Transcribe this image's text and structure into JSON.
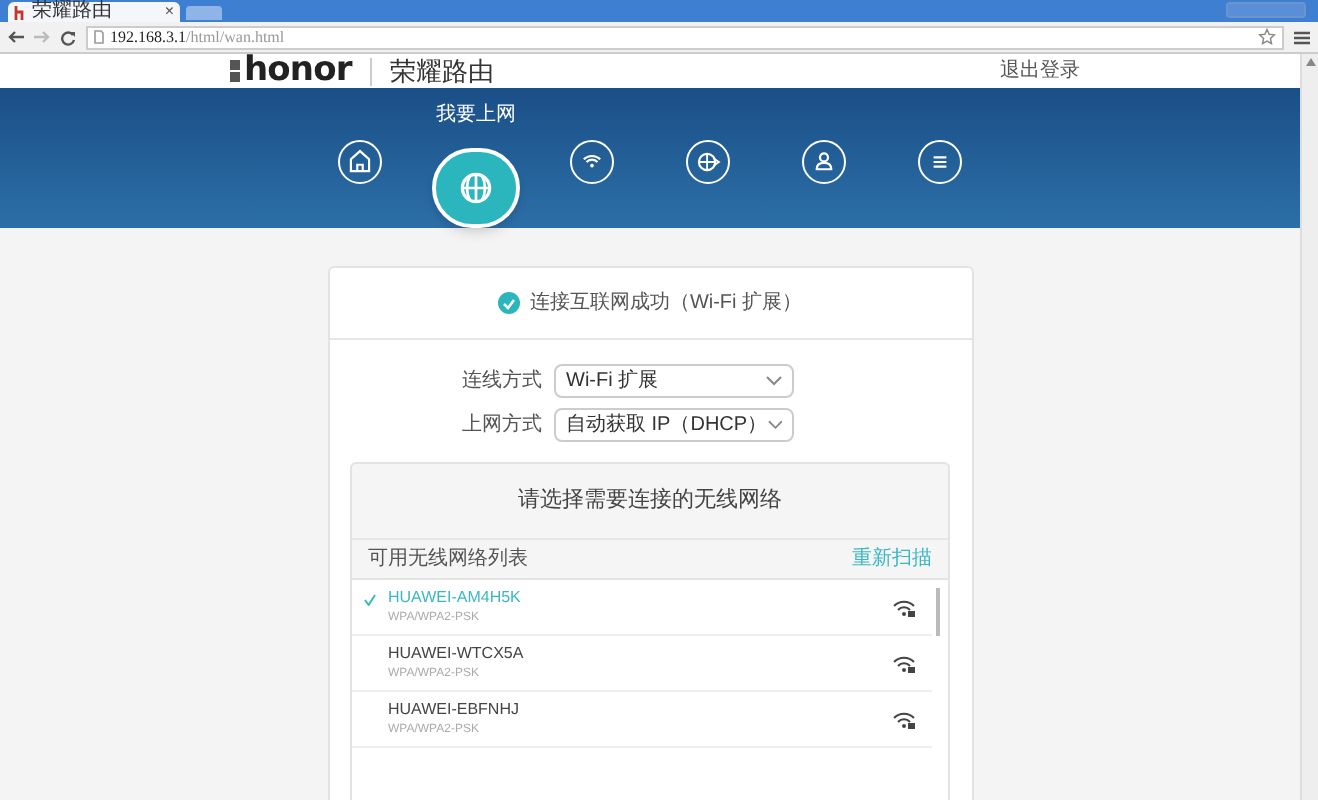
{
  "browser": {
    "tab_title": "荣耀路由",
    "tab_close": "×",
    "url_host": "192.168.3.1",
    "url_path": "/html/wan.html"
  },
  "header": {
    "logo": "honor",
    "product": "荣耀路由",
    "logout": "退出登录"
  },
  "nav": [
    {
      "kind": "home",
      "selected": false
    },
    {
      "kind": "globe",
      "selected": true,
      "label": "我要上网"
    },
    {
      "kind": "wifi",
      "selected": false
    },
    {
      "kind": "globe-arrow",
      "selected": false
    },
    {
      "kind": "user",
      "selected": false
    },
    {
      "kind": "menu",
      "selected": false
    }
  ],
  "status": {
    "checked": true,
    "text": "连接互联网成功（Wi-Fi 扩展）"
  },
  "form": [
    {
      "label": "连线方式",
      "value": "Wi-Fi 扩展"
    },
    {
      "label": "上网方式",
      "value": "自动获取 IP（DHCP）"
    }
  ],
  "wifi_panel": {
    "title": "请选择需要连接的无线网络",
    "list_label": "可用无线网络列表",
    "rescan": "重新扫描",
    "networks": [
      {
        "name": "HUAWEI-AM4H5K",
        "security": "WPA/WPA2-PSK",
        "selected": true
      },
      {
        "name": "HUAWEI-WTCX5A",
        "security": "WPA/WPA2-PSK",
        "selected": false
      },
      {
        "name": "HUAWEI-EBFNHJ",
        "security": "WPA/WPA2-PSK",
        "selected": false
      }
    ]
  }
}
